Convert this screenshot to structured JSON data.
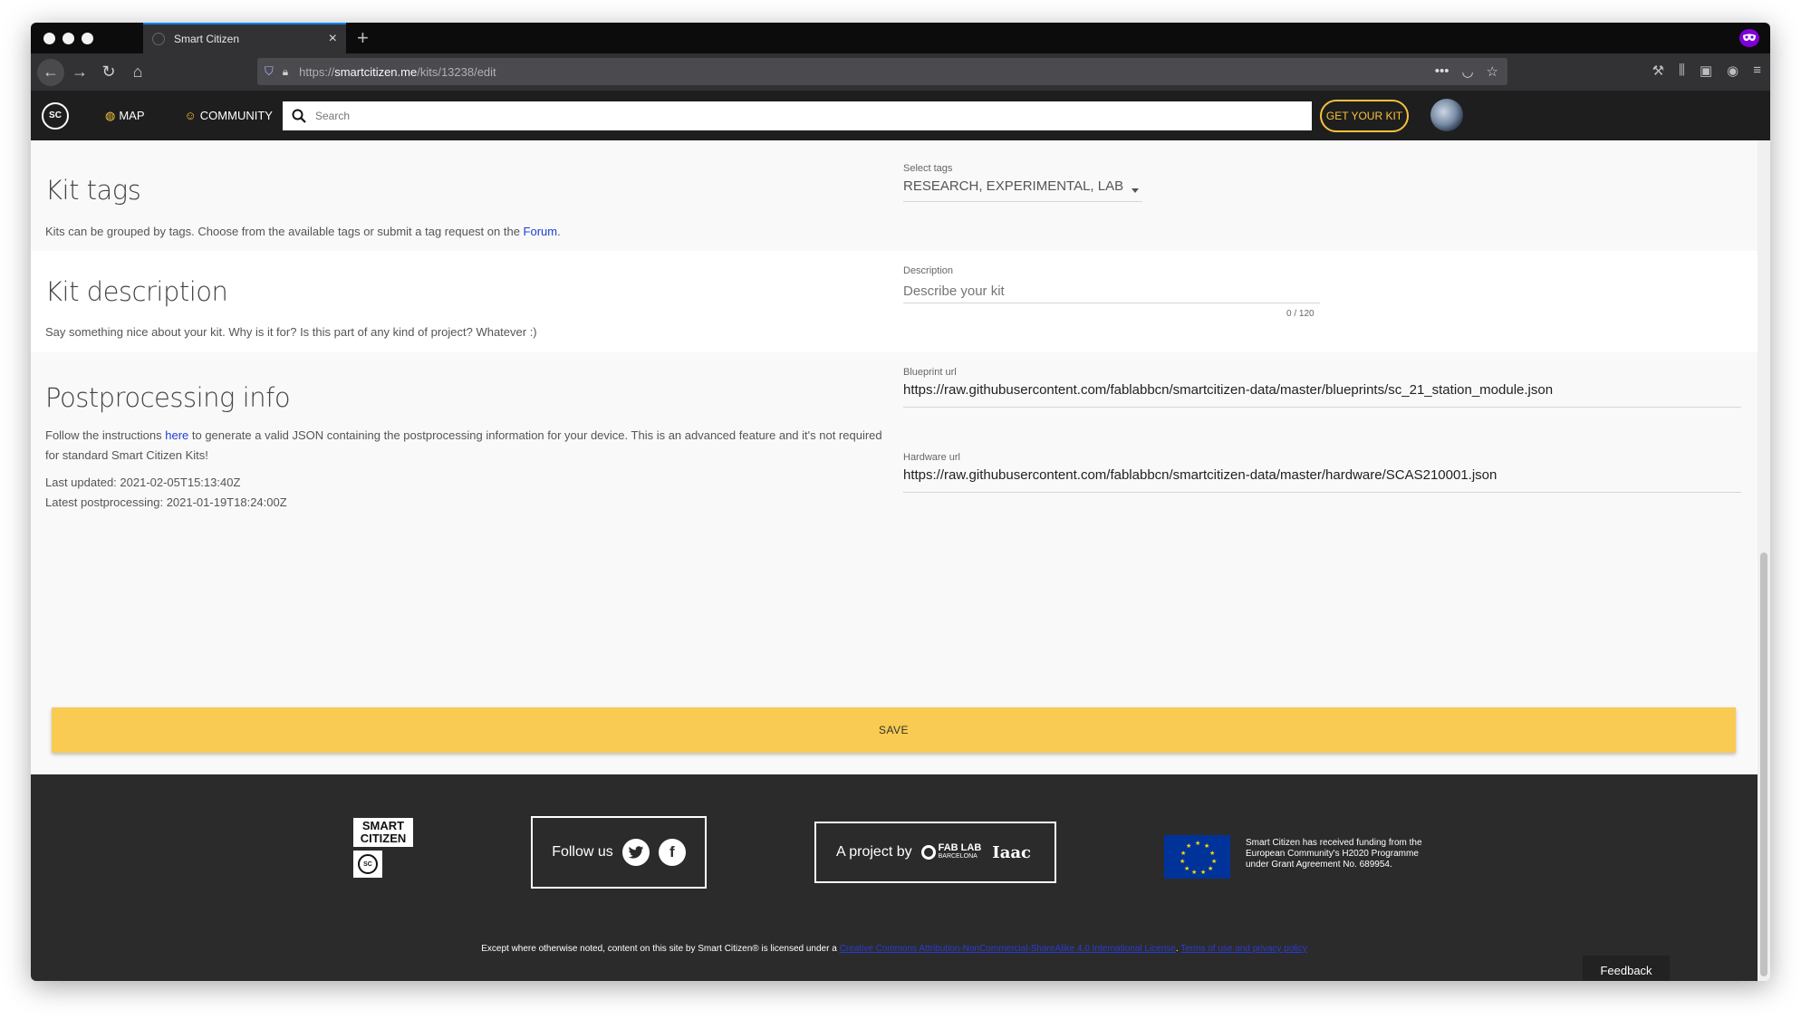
{
  "browser": {
    "tab_title": "Smart Citizen",
    "new_tab_symbol": "+",
    "tab_close_symbol": "×",
    "url_prefix": "https://",
    "url_domain": "smartcitizen.me",
    "url_path": "/kits/13238/edit"
  },
  "nav": {
    "logo_text": "SC",
    "map_label": "MAP",
    "community_label": "COMMUNITY",
    "search_placeholder": "Search",
    "get_kit_label": "GET YOUR KIT"
  },
  "tags": {
    "title": "Kit tags",
    "text_before": "Kits can be grouped by tags. Choose from the available tags or submit a tag request on the ",
    "link": "Forum",
    "text_after": ".",
    "field_label": "Select tags",
    "selected": "RESEARCH, EXPERIMENTAL, LAB"
  },
  "description": {
    "title": "Kit description",
    "text": "Say something nice about your kit. Why is it for? Is this part of any kind of project? Whatever :)",
    "field_label": "Description",
    "placeholder": "Describe your kit",
    "counter": "0 / 120"
  },
  "postprocessing": {
    "title": "Postprocessing info",
    "text_before": "Follow the instructions ",
    "link": "here",
    "text_after": " to generate a valid JSON containing the postprocessing information for your device. This is an advanced feature and it's not required for standard Smart Citizen Kits!",
    "last_updated": "Last updated: 2021-02-05T15:13:40Z",
    "latest_postprocessing": "Latest postprocessing: 2021-01-19T18:24:00Z",
    "blueprint_label": "Blueprint url",
    "blueprint_value": "https://raw.githubusercontent.com/fablabbcn/smartcitizen-data/master/blueprints/sc_21_station_module.json",
    "hardware_label": "Hardware url",
    "hardware_value": "https://raw.githubusercontent.com/fablabbcn/smartcitizen-data/master/hardware/SCAS210001.json"
  },
  "save_label": "SAVE",
  "footer": {
    "logo_line1": "SMART",
    "logo_line2": "CITIZEN",
    "logo_mark": "SC",
    "follow_label": "Follow us",
    "project_label": "A project by",
    "fablab_line1": "FAB LAB",
    "fablab_line2": "BARCELONA",
    "iaac": "Iaac",
    "eu_text": "Smart Citizen has received funding from the European Community's H2020 Programme under Grant Agreement No. 689954.",
    "license_text": "Except where otherwise noted, content on this site by Smart Citizen® is licensed under a ",
    "license_link": "Creative Commons Attribution-NonCommercial-ShareAlike 4.0 International License",
    "separator": ". ",
    "terms_link": "Terms of use and privacy policy",
    "feedback_label": "Feedback"
  },
  "colors": {
    "accent_yellow": "#f9cb52",
    "nav_yellow": "#f5c33c",
    "link_blue": "#1f3ed8",
    "footer_bg": "#2b2b2b",
    "eu_blue": "#003399"
  }
}
